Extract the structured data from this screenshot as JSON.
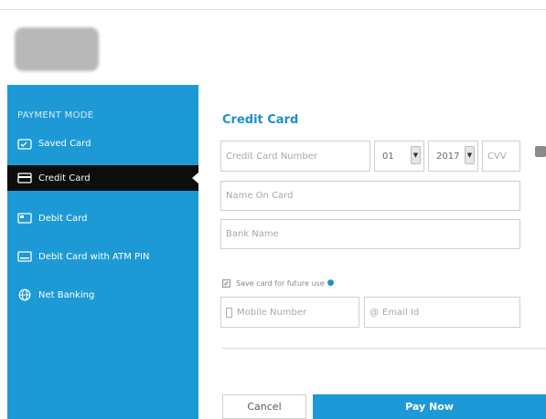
{
  "sidebar": {
    "title": "PAYMENT MODE",
    "items": [
      {
        "label": "Saved Card",
        "icon": "saved-card-icon"
      },
      {
        "label": "Credit Card",
        "icon": "credit-card-icon",
        "active": true
      },
      {
        "label": "Debit Card",
        "icon": "debit-card-icon"
      },
      {
        "label": "Debit Card with ATM PIN",
        "icon": "atm-card-icon"
      },
      {
        "label": "Net Banking",
        "icon": "globe-icon"
      }
    ]
  },
  "form": {
    "title": "Credit Card",
    "card_number_placeholder": "Credit Card Number",
    "expiry_month": "01",
    "expiry_year": "2017",
    "cvv_placeholder": "CVV",
    "name_placeholder": "Name On Card",
    "bank_placeholder": "Bank Name",
    "save_label": "Save card for future use",
    "mobile_placeholder": "Mobile Number",
    "email_placeholder": "Email Id"
  },
  "actions": {
    "cancel_label": "Cancel",
    "pay_label": "Pay Now"
  },
  "colors": {
    "accent": "#1d9ad6",
    "active_item": "#0d0d0d"
  }
}
